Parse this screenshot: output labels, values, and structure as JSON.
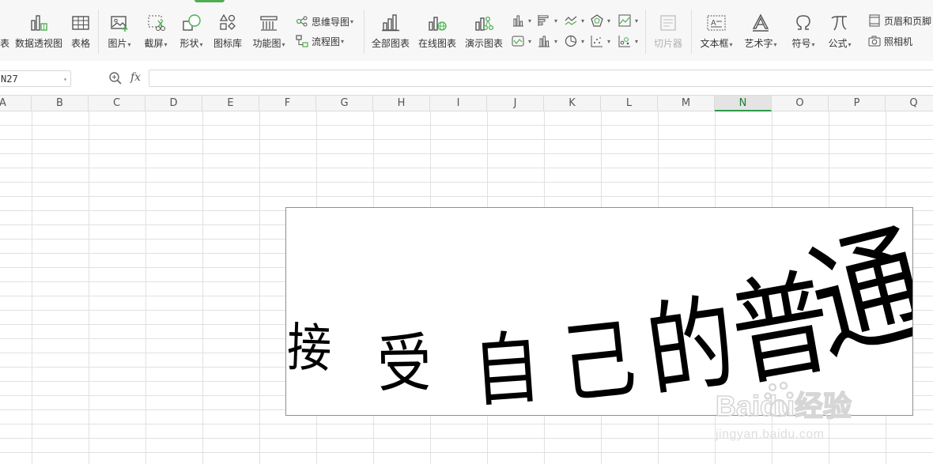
{
  "ribbon": {
    "buttons_large": [
      {
        "label": "表",
        "icon": "pivot-table-icon-partial"
      },
      {
        "label": "数据透视图",
        "icon": "pivot-chart-icon"
      },
      {
        "label": "表格",
        "icon": "table-icon"
      },
      {
        "label": "图片",
        "icon": "picture-icon",
        "caret": true
      },
      {
        "label": "截屏",
        "icon": "screenshot-icon",
        "caret": true
      },
      {
        "label": "形状",
        "icon": "shapes-icon",
        "caret": true
      },
      {
        "label": "图标库",
        "icon": "icon-library-icon"
      },
      {
        "label": "功能图",
        "icon": "function-chart-icon",
        "caret": true
      },
      {
        "label": "全部图表",
        "icon": "all-charts-icon"
      },
      {
        "label": "在线图表",
        "icon": "online-charts-icon"
      },
      {
        "label": "演示图表",
        "icon": "demo-charts-icon"
      },
      {
        "label": "切片器",
        "icon": "slicer-icon",
        "disabled": true
      },
      {
        "label": "文本框",
        "icon": "textbox-icon",
        "caret": true
      },
      {
        "label": "艺术字",
        "icon": "wordart-icon",
        "caret": true
      },
      {
        "label": "符号",
        "icon": "omega-symbol-icon",
        "caret": true
      },
      {
        "label": "公式",
        "icon": "pi-formula-icon",
        "caret": true
      }
    ],
    "mindmap_label": "思维导图",
    "flowchart_label": "流程图",
    "header_footer_label": "页眉和页脚",
    "camera_label": "照相机"
  },
  "formula_bar": {
    "name_box": "N27",
    "fx": "fx",
    "formula": ""
  },
  "columns": [
    "A",
    "B",
    "C",
    "D",
    "E",
    "F",
    "G",
    "H",
    "I",
    "J",
    "K",
    "L",
    "M",
    "N",
    "O",
    "P",
    "Q"
  ],
  "active_column": "N",
  "wordart": {
    "chars": [
      "接",
      "受",
      "自",
      "己",
      "的",
      "普",
      "通"
    ]
  },
  "watermark": {
    "brand": "Baidu经验",
    "url": "jingyan.baidu.com"
  },
  "colors": {
    "accent": "#2e9c48",
    "ribbon_bg": "#f7f7f7",
    "grid_line": "#e1e1e1"
  }
}
